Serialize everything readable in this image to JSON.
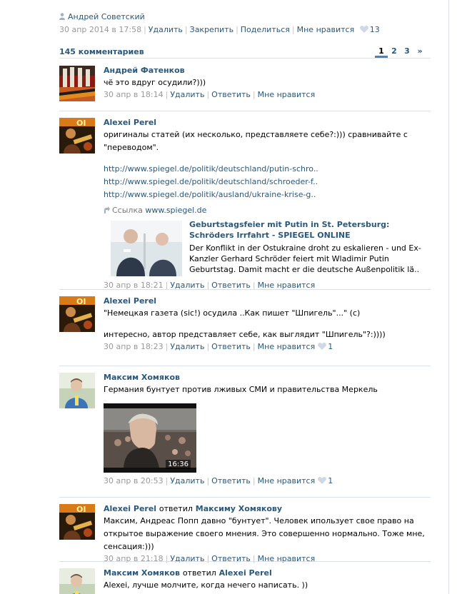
{
  "post": {
    "author": "Андрей Советский",
    "date": "30 апр 2014 в 17:58",
    "actions": {
      "delete": "Удалить",
      "pin": "Закрепить",
      "share": "Поделиться",
      "like": "Мне нравится"
    },
    "likes": "13"
  },
  "comments_header": {
    "count_label": "145 комментариев",
    "pages": [
      "1",
      "2",
      "3",
      "»"
    ]
  },
  "actions": {
    "delete": "Удалить",
    "reply": "Ответить",
    "like": "Мне нравится"
  },
  "comments": [
    {
      "author": "Андрей Фатенков",
      "text": "чё это вдруг осудили?)))",
      "date": "30 апр в 18:14"
    },
    {
      "author": "Alexei Perel",
      "text": "оригиналы статей (их несколько, представляете себе?:))) сравнивайте с \"переводом\".",
      "links": [
        "http://www.spiegel.de/politik/deutschland/putin-schro..",
        "http://www.spiegel.de/politik/deutschland/schroeder-f..",
        "http://www.spiegel.de/politik/ausland/ukraine-krise-g.."
      ],
      "share": {
        "label": "Ссылка",
        "domain": "www.spiegel.de",
        "title": "Geburtstagsfeier mit Putin in St. Petersburg: Schröders Irrfahrt - SPIEGEL ONLINE",
        "description": "Der Konflikt in der Ostukraine droht zu eskalieren - und Ex-Kanzler Gerhard Schröder feiert mit Wladimir Putin Geburtstag. Damit macht er die deutsche Außenpolitik lä.."
      },
      "date": "30 апр в 18:21"
    },
    {
      "author": "Alexei Perel",
      "text_line1": "\"Немецкая газета (sic!) осудила ..Как пишет \"Шпигель\"...\" (с)",
      "text_line2": "интересно, автор представляет себе, как выглядит \"Шпигель\"?:))))",
      "date": "30 апр в 18:23",
      "likes": "1"
    },
    {
      "author": "Максим Хомяков",
      "text": "Германия бунтует против лживых СМИ и правительства Меркель",
      "video_duration": "16:36",
      "date": "30 апр в 20:53",
      "likes": "1"
    },
    {
      "author": "Alexei Perel",
      "reply_word": "ответил",
      "reply_to": "Максиму Хомякову",
      "text": "Максим, Андреас Попп давно \"бунтует\". Человек ипользует свое право на открытое выражение своего мнения. Это совершенно нормально. Тоже мне, сенсация:)))",
      "date": "30 апр в 21:18"
    },
    {
      "author": "Максим Хомяков",
      "reply_word": "ответил",
      "reply_to": "Alexei Perel",
      "text": "Alexei, лучше молчите, когда нечего написать. ))"
    }
  ],
  "colors": {
    "link": "#2b587a",
    "meta": "#999999",
    "divider": "#dae1e8",
    "heart": "#cfd9e5"
  }
}
